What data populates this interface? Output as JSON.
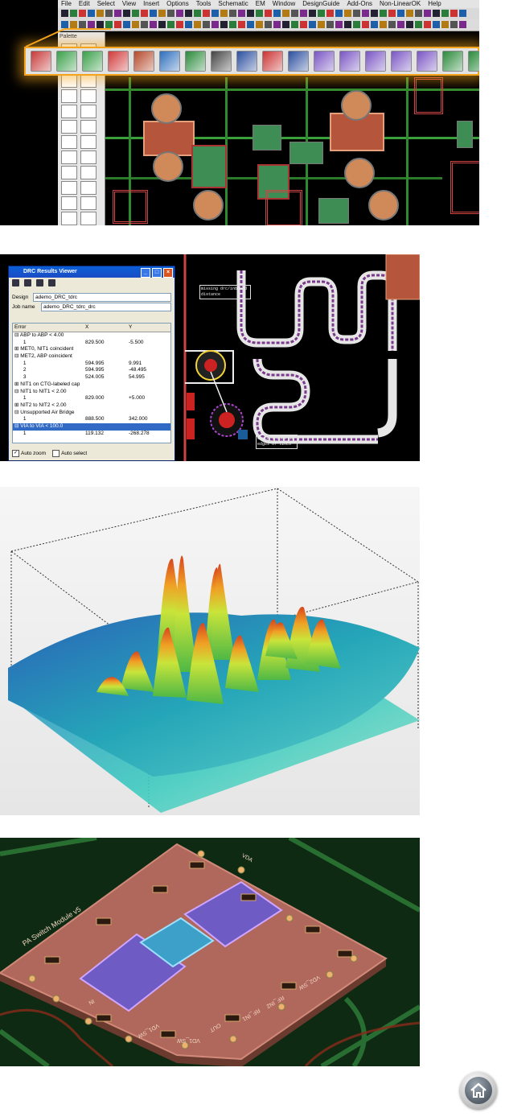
{
  "panel1": {
    "menus": [
      "File",
      "Edit",
      "Select",
      "View",
      "Insert",
      "Options",
      "Tools",
      "Schematic",
      "EM",
      "Window",
      "DesignGuide",
      "Add-Ons",
      "Non-LinearOK",
      "Help"
    ],
    "palette_title": "Palette"
  },
  "panel2": {
    "window_title": "DRC Results Viewer",
    "design_label": "Design",
    "design_value": "ademo_DRC_tdrc",
    "job_label": "Job name",
    "job_value": "ademo_DRC_tdrc_drc",
    "columns": [
      "Error",
      "X",
      "Y"
    ],
    "rows": [
      {
        "error": "⊟ ABP to ABP < 4.00",
        "x": "",
        "y": ""
      },
      {
        "error": "      1",
        "x": "829.500",
        "y": "-5.500"
      },
      {
        "error": "⊞ MET0, NIT1 coincident",
        "x": "",
        "y": ""
      },
      {
        "error": "⊟ MET2, ABP coincident",
        "x": "",
        "y": ""
      },
      {
        "error": "      1",
        "x": "594.995",
        "y": "9.991"
      },
      {
        "error": "      2",
        "x": "594.995",
        "y": "-48.495"
      },
      {
        "error": "      3",
        "x": "524.005",
        "y": "54.995"
      },
      {
        "error": "⊞ NIT1 on CTG-labeled cap",
        "x": "",
        "y": ""
      },
      {
        "error": "⊟ NIT1 to NIT1 < 2.00",
        "x": "",
        "y": ""
      },
      {
        "error": "      1",
        "x": "829.000",
        "y": "+5.000"
      },
      {
        "error": "⊞ NIT2 to NIT2 < 2.00",
        "x": "",
        "y": ""
      },
      {
        "error": "⊟ Unsupported Air Bridge",
        "x": "",
        "y": ""
      },
      {
        "error": "      1",
        "x": "888.500",
        "y": "342.000"
      },
      {
        "error": "⊟ VIA to VIA < 100.0",
        "x": "",
        "y": "",
        "selected": true
      },
      {
        "error": "      1",
        "x": "119.132",
        "y": "-268.278"
      }
    ],
    "auto_zoom": "Auto zoom",
    "auto_select": "Auto select",
    "annotation_top": "missing drc/inbound distance",
    "annotation_bottom": "Check Traces at edges of lines"
  },
  "panel4": {
    "board_label": "PA Switch Module v5",
    "pin_labels": [
      "VDA",
      "VD1_SW",
      "IN",
      "OUT",
      "RF_IN1",
      "RF_IN2",
      "VD2_SW",
      "VD1_SW"
    ]
  },
  "home": {
    "icon": "home-icon"
  },
  "colors": {
    "highlight": "#f2a41c",
    "trace": "#2f8a2f",
    "pad": "#c8734a",
    "selection": "#316ac5"
  }
}
